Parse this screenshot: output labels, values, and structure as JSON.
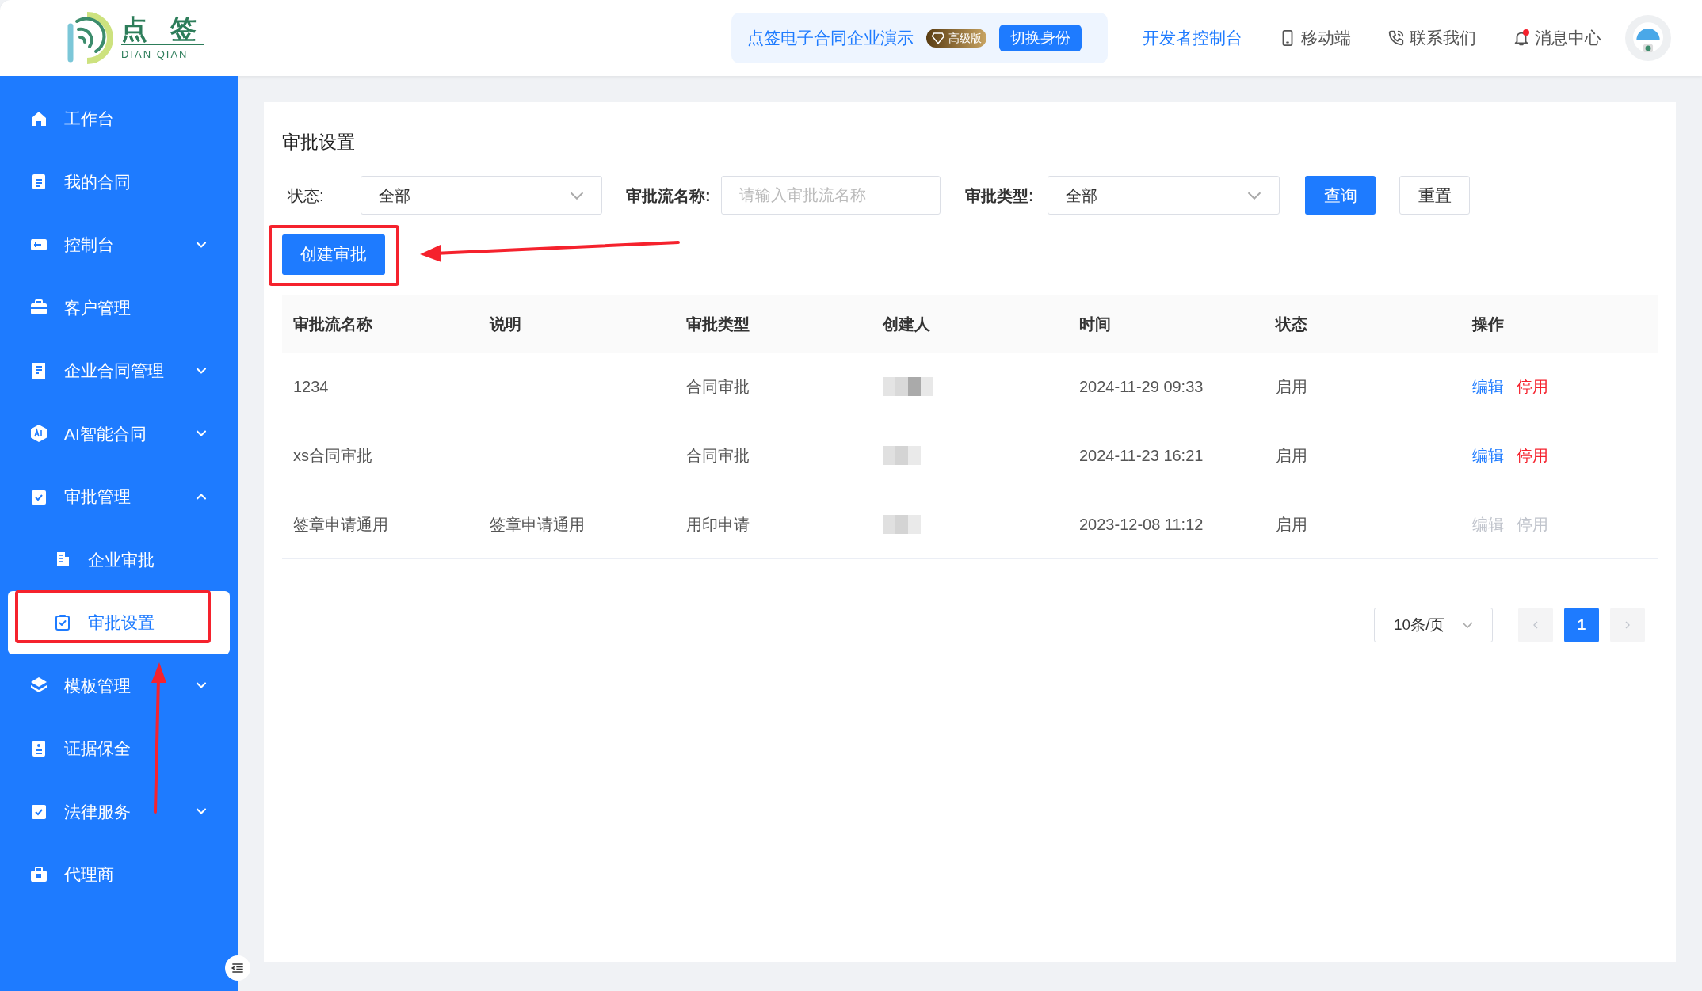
{
  "header": {
    "logo": {
      "title": "点 签",
      "subtitle": "DIAN QIAN"
    },
    "company": "点签电子合同企业演示",
    "badge": "高级版",
    "switch_button": "切换身份",
    "links": [
      {
        "kind": "developer",
        "label": "开发者控制台"
      },
      {
        "kind": "mobile",
        "label": "移动端"
      },
      {
        "kind": "contact",
        "label": "联系我们"
      },
      {
        "kind": "messages",
        "label": "消息中心",
        "unread": true
      }
    ]
  },
  "sidebar": {
    "items": [
      {
        "label": "工作台",
        "selected": false
      },
      {
        "label": "我的合同",
        "selected": false
      },
      {
        "label": "控制台",
        "selected": false,
        "expanded": false
      },
      {
        "label": "客户管理",
        "selected": false
      },
      {
        "label": "企业合同管理",
        "selected": false,
        "expanded": false
      },
      {
        "label": "AI智能合同",
        "selected": false,
        "expanded": false
      },
      {
        "label": "审批管理",
        "selected": false,
        "expanded": true,
        "children": [
          {
            "label": "企业审批",
            "selected": false
          },
          {
            "label": "审批设置",
            "selected": true
          }
        ]
      },
      {
        "label": "模板管理",
        "selected": false,
        "expanded": false
      },
      {
        "label": "证据保全",
        "selected": false
      },
      {
        "label": "法律服务",
        "selected": false,
        "expanded": false
      },
      {
        "label": "代理商",
        "selected": false
      }
    ]
  },
  "page": {
    "title": "审批设置",
    "filters": {
      "status_label": "状态:",
      "status_value": "全部",
      "name_label": "审批流名称:",
      "name_placeholder": "请输入审批流名称",
      "type_label": "审批类型:",
      "type_value": "全部"
    },
    "query_button": "查询",
    "reset_button": "重置",
    "create_button": "创建审批",
    "table": {
      "columns": [
        "审批流名称",
        "说明",
        "审批类型",
        "创建人",
        "时间",
        "状态",
        "操作"
      ],
      "rows": [
        {
          "name": "1234",
          "description": "",
          "type": "合同审批",
          "time": "2024-11-29 09:33",
          "status": "启用",
          "actions": [
            "编辑",
            "停用"
          ],
          "disabled": false
        },
        {
          "name": "xs合同审批",
          "description": "",
          "type": "合同审批",
          "time": "2024-11-23 16:21",
          "status": "启用",
          "actions": [
            "编辑",
            "停用"
          ],
          "disabled": false
        },
        {
          "name": "签章申请通用",
          "description": "签章申请通用",
          "type": "用印申请",
          "time": "2023-12-08 11:12",
          "status": "启用",
          "actions": [
            "编辑",
            "停用"
          ],
          "disabled": true
        }
      ]
    },
    "pagination": {
      "page_size": "10条/页",
      "pages": [
        {
          "label": "1",
          "selected": true
        }
      ]
    }
  }
}
